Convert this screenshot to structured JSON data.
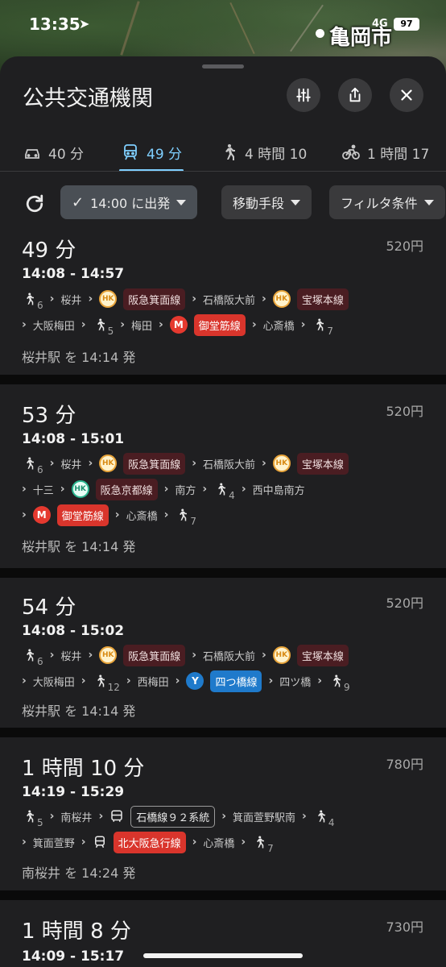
{
  "status": {
    "time": "13:35",
    "network": "4G",
    "battery": "97"
  },
  "map": {
    "city": "亀岡市"
  },
  "sheet": {
    "title": "公共交通機関"
  },
  "modes": [
    {
      "label": "40 分",
      "icon": "car-icon"
    },
    {
      "label": "49 分",
      "icon": "train-icon",
      "active": true
    },
    {
      "label": "4 時間 10",
      "icon": "walk-icon"
    },
    {
      "label": "1 時間 17",
      "icon": "bike-icon"
    }
  ],
  "filters": {
    "depart": "14:00 に出発",
    "mode": "移動手段",
    "criteria": "フィルタ条件"
  },
  "routes": [
    {
      "duration": "49 分",
      "price": "520円",
      "time": "14:08 - 14:57",
      "depart": "桜井駅 を 14:14 発",
      "s": {
        "w1": "6",
        "st1": "桜井",
        "hk": "HK",
        "l1": "阪急箕面線",
        "st2": "石橋阪大前",
        "l2": "宝塚本線",
        "st3": "大阪梅田",
        "w2": "5",
        "st4": "梅田",
        "m": "M",
        "l3": "御堂筋線",
        "st5": "心斎橋",
        "w3": "7"
      }
    },
    {
      "duration": "53 分",
      "price": "520円",
      "time": "14:08 - 15:01",
      "depart": "桜井駅 を 14:14 発",
      "s": {
        "w1": "6",
        "st1": "桜井",
        "hk": "HK",
        "l1": "阪急箕面線",
        "st2": "石橋阪大前",
        "l2": "宝塚本線",
        "st3": "十三",
        "l3": "阪急京都線",
        "st4": "南方",
        "w2": "4",
        "st5": "西中島南方",
        "m": "M",
        "l4": "御堂筋線",
        "st6": "心斎橋",
        "w3": "7"
      }
    },
    {
      "duration": "54 分",
      "price": "520円",
      "time": "14:08 - 15:02",
      "depart": "桜井駅 を 14:14 発",
      "s": {
        "w1": "6",
        "st1": "桜井",
        "hk": "HK",
        "l1": "阪急箕面線",
        "st2": "石橋阪大前",
        "l2": "宝塚本線",
        "st3": "大阪梅田",
        "w2": "12",
        "st4": "西梅田",
        "y": "Y",
        "l3": "四つ橋線",
        "st5": "四ツ橋",
        "w3": "9"
      }
    },
    {
      "duration": "1 時間 10 分",
      "price": "780円",
      "time": "14:19 - 15:29",
      "depart": "南桜井 を 14:24 発",
      "s": {
        "w1": "5",
        "st1": "南桜井",
        "l1": "石橋線９２系統",
        "st2": "箕面萱野駅南",
        "w2": "4",
        "st3": "箕面萱野",
        "l2": "北大阪急行線",
        "st4": "心斎橋",
        "w3": "7"
      }
    },
    {
      "duration": "1 時間 8 分",
      "price": "730円",
      "time": "14:09 - 15:17"
    }
  ]
}
